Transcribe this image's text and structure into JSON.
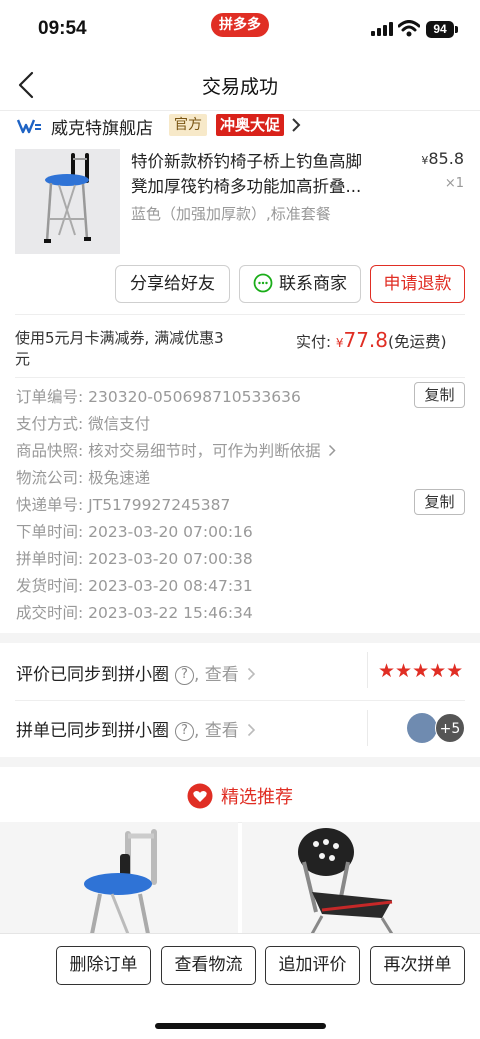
{
  "status_bar": {
    "time": "09:54",
    "app_pill": "拼多多",
    "battery": "94"
  },
  "nav": {
    "title": "交易成功"
  },
  "store": {
    "name": "威克特旗舰店",
    "badge_official": "官方",
    "badge_promo": "冲奥大促"
  },
  "product": {
    "title_line1": "特价新款桥钓椅子桥上钓鱼高脚",
    "title_line2": "凳加厚筏钓椅多功能加高折叠...",
    "price_symbol": "¥",
    "price": "85.8",
    "qty": "×1",
    "spec": "蓝色（加强加厚款）,标准套餐"
  },
  "actions": {
    "share": "分享给好友",
    "contact": "联系商家",
    "refund": "申请退款"
  },
  "payment": {
    "coupon": "使用5元月卡满减券, 满减优惠3元",
    "paid_label": "实付: ",
    "currency": "¥",
    "paid_amount": "77.8",
    "shipping_note": "(免运费)"
  },
  "order_info": [
    {
      "key": "订单编号: ",
      "value": "230320-050698710533636"
    },
    {
      "key": "支付方式: ",
      "value": "微信支付"
    },
    {
      "key": "商品快照: ",
      "value": "核对交易细节时，可作为判断依据"
    },
    {
      "key": "物流公司: ",
      "value": "极兔速递"
    },
    {
      "key": "快递单号: ",
      "value": "JT5179927245387"
    },
    {
      "key": "下单时间: ",
      "value": "2023-03-20 07:00:16"
    },
    {
      "key": "拼单时间: ",
      "value": "2023-03-20 07:00:38"
    },
    {
      "key": "发货时间: ",
      "value": "2023-03-20 08:47:31"
    },
    {
      "key": "成交时间: ",
      "value": "2023-03-22 15:46:34"
    }
  ],
  "copy_label": "复制",
  "sync": {
    "review_text": "评价已同步到拼小圈",
    "review_view": ", 查看",
    "rating": 5,
    "group_text": "拼单已同步到拼小圈",
    "group_view": ", 查看",
    "group_more": "+5"
  },
  "recommend": {
    "title": "精选推荐"
  },
  "bottom_bar": {
    "delete": "删除订单",
    "logistics": "查看物流",
    "add_review": "追加评价",
    "rebuy": "再次拼单"
  },
  "colors": {
    "brand_red": "#e02e24",
    "gray_text": "#999999"
  }
}
